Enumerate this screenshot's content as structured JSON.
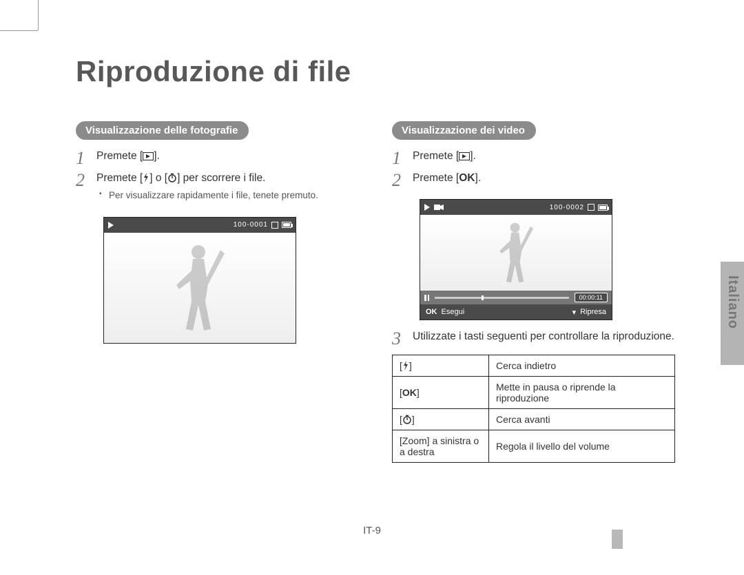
{
  "title": "Riproduzione di file",
  "left": {
    "pill": "Visualizzazione delle fotografie",
    "step1": "Premete [",
    "step1_end": "].",
    "step2": "Premete [",
    "step2_mid": "] o [",
    "step2_end": "] per scorrere i file.",
    "note": "Per visualizzare rapidamente i file, tenete premuto.",
    "file_counter": "100-0001"
  },
  "right": {
    "pill": "Visualizzazione dei video",
    "step1": "Premete [",
    "step1_end": "].",
    "step2": "Premete [",
    "step2_end": "].",
    "file_counter": "100-0002",
    "time": "00:00:11",
    "foot_ok": "OK",
    "foot_exec": "Esegui",
    "foot_rec": "Ripresa",
    "step3": "Utilizzate i tasti seguenti per controllare la riproduzione.",
    "table": [
      {
        "desc": "Cerca indietro"
      },
      {
        "desc": "Mette in pausa o riprende la riproduzione"
      },
      {
        "desc": "Cerca avanti"
      },
      {
        "key": "[Zoom] a sinistra o a destra",
        "desc": "Regola il livello del volume"
      }
    ]
  },
  "side_label": "Italiano",
  "page_number": "IT-9"
}
